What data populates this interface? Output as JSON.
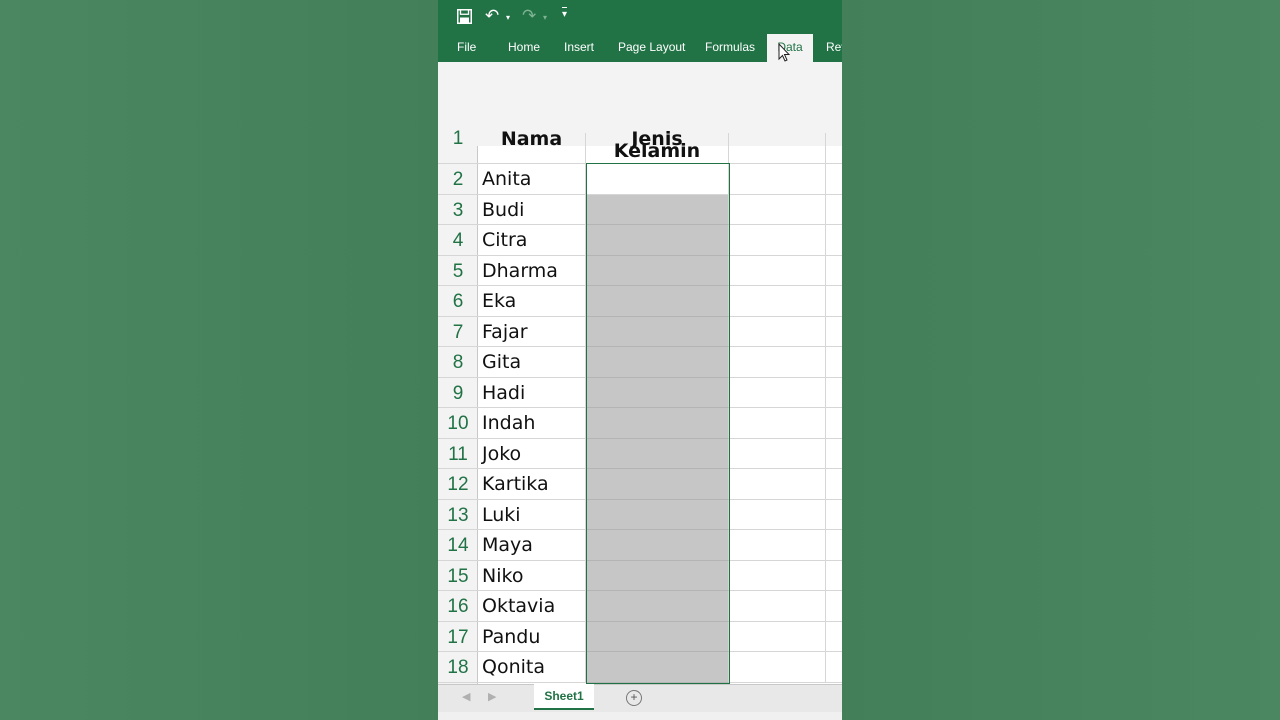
{
  "colors": {
    "accent": "#217346",
    "background": "#4a8660",
    "selection": "#c6c6c6"
  },
  "quick_access": {
    "save_icon": "save-icon",
    "undo_icon": "undo-icon",
    "redo_icon": "redo-icon",
    "customize_icon": "customize-qat-icon",
    "undo_glyph": "↶",
    "undo_drop": "▾",
    "redo_glyph": "↷",
    "redo_drop": "▾",
    "customize_glyph": "▾"
  },
  "ribbon": {
    "tabs": [
      {
        "label": "File"
      },
      {
        "label": "Home"
      },
      {
        "label": "Insert"
      },
      {
        "label": "Page Layout"
      },
      {
        "label": "Formulas"
      },
      {
        "label": "Data",
        "active": true
      },
      {
        "label": "Rev"
      }
    ]
  },
  "sheet": {
    "header_row": {
      "number": "1",
      "col_a": "Nama",
      "col_b": "Jenis Kelamin"
    },
    "rows": [
      {
        "number": "2",
        "name": "Anita"
      },
      {
        "number": "3",
        "name": "Budi"
      },
      {
        "number": "4",
        "name": "Citra"
      },
      {
        "number": "5",
        "name": "Dharma"
      },
      {
        "number": "6",
        "name": "Eka"
      },
      {
        "number": "7",
        "name": "Fajar"
      },
      {
        "number": "8",
        "name": "Gita"
      },
      {
        "number": "9",
        "name": "Hadi"
      },
      {
        "number": "10",
        "name": "Indah"
      },
      {
        "number": "11",
        "name": "Joko"
      },
      {
        "number": "12",
        "name": "Kartika"
      },
      {
        "number": "13",
        "name": "Luki"
      },
      {
        "number": "14",
        "name": "Maya"
      },
      {
        "number": "15",
        "name": "Niko"
      },
      {
        "number": "16",
        "name": "Oktavia"
      },
      {
        "number": "17",
        "name": "Pandu"
      },
      {
        "number": "18",
        "name": "Qonita"
      }
    ]
  },
  "sheet_tabs": {
    "prev_glyph": "◀",
    "next_glyph": "▶",
    "active": "Sheet1",
    "add_glyph": "+"
  }
}
